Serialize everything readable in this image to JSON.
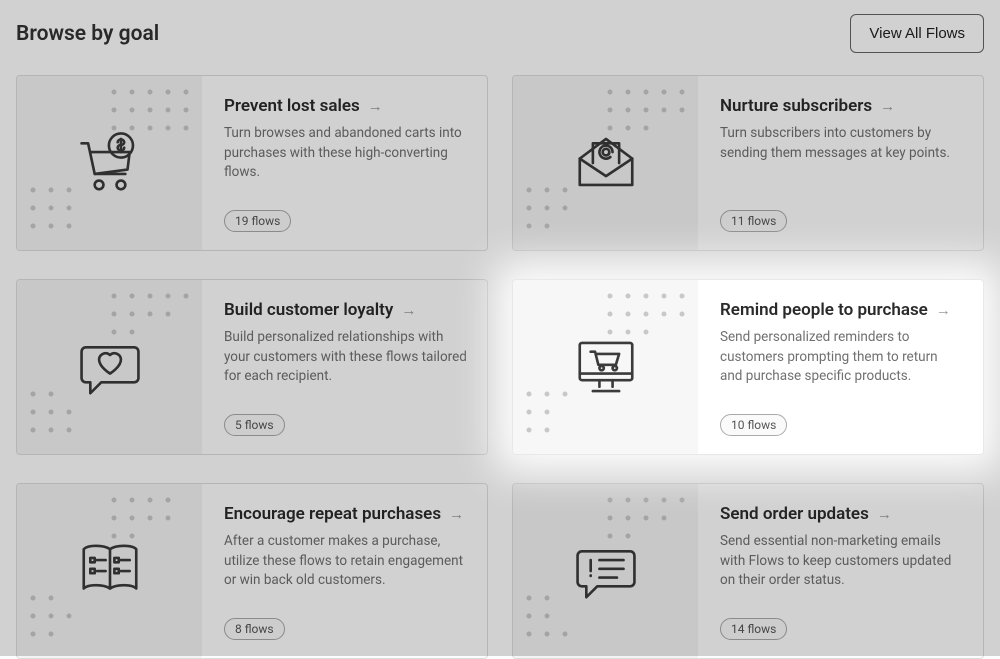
{
  "header": {
    "title": "Browse by goal",
    "view_all": "View All Flows"
  },
  "cards": [
    {
      "icon": "cart-dollar-icon",
      "title": "Prevent lost sales",
      "desc": "Turn browses and abandoned carts into purchases with these high-converting flows.",
      "count": "19 flows",
      "highlighted": false
    },
    {
      "icon": "envelope-at-icon",
      "title": "Nurture subscribers",
      "desc": "Turn subscribers into customers by sending them messages at key points.",
      "count": "11 flows",
      "highlighted": false
    },
    {
      "icon": "heart-bubble-icon",
      "title": "Build customer loyalty",
      "desc": "Build personalized relationships with your customers with these flows tailored for each recipient.",
      "count": "5 flows",
      "highlighted": false
    },
    {
      "icon": "monitor-cart-icon",
      "title": "Remind people to purchase",
      "desc": "Send personalized reminders to customers prompting them to return and purchase specific products.",
      "count": "10 flows",
      "highlighted": true
    },
    {
      "icon": "book-checklist-icon",
      "title": "Encourage repeat purchases",
      "desc": "After a customer makes a purchase, utilize these flows to retain engagement or win back old customers.",
      "count": "8 flows",
      "highlighted": false
    },
    {
      "icon": "alert-bubble-icon",
      "title": "Send order updates",
      "desc": "Send essential non-marketing emails with Flows to keep customers updated on their order status.",
      "count": "14 flows",
      "highlighted": false
    }
  ]
}
